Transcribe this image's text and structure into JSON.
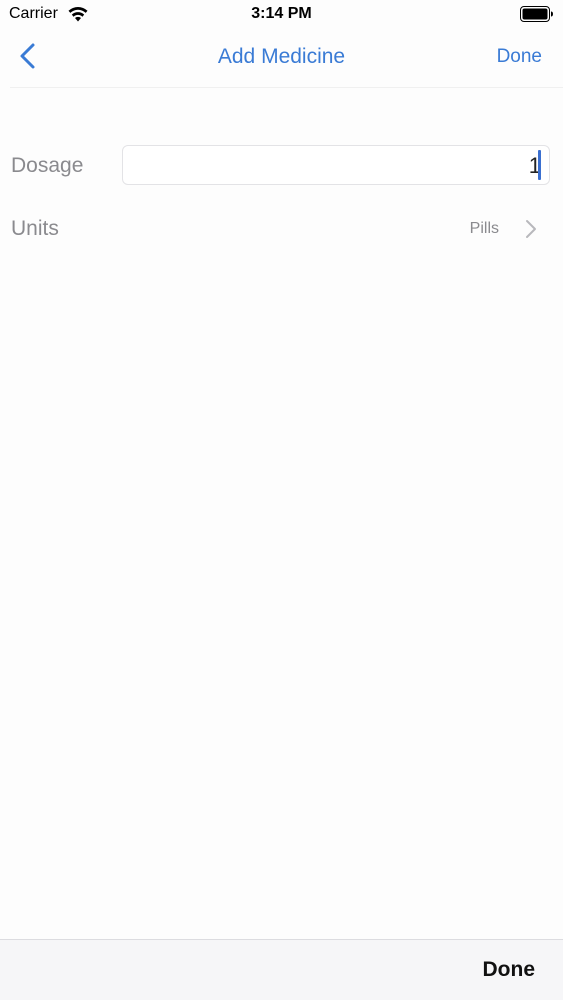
{
  "status_bar": {
    "carrier": "Carrier",
    "time": "3:14 PM",
    "wifi_icon": "wifi-icon",
    "battery_icon": "battery-icon"
  },
  "nav": {
    "back_icon": "chevron-left-icon",
    "title": "Add Medicine",
    "done_label": "Done"
  },
  "form": {
    "dosage": {
      "label": "Dosage",
      "value": "1"
    },
    "units": {
      "label": "Units",
      "value": "Pills",
      "chevron_icon": "chevron-right-icon"
    }
  },
  "keyboard_accessory": {
    "done_label": "Done"
  },
  "colors": {
    "accent": "#3a7bd5",
    "label_gray": "#8a8a8e",
    "cursor": "#3a6fd0"
  }
}
